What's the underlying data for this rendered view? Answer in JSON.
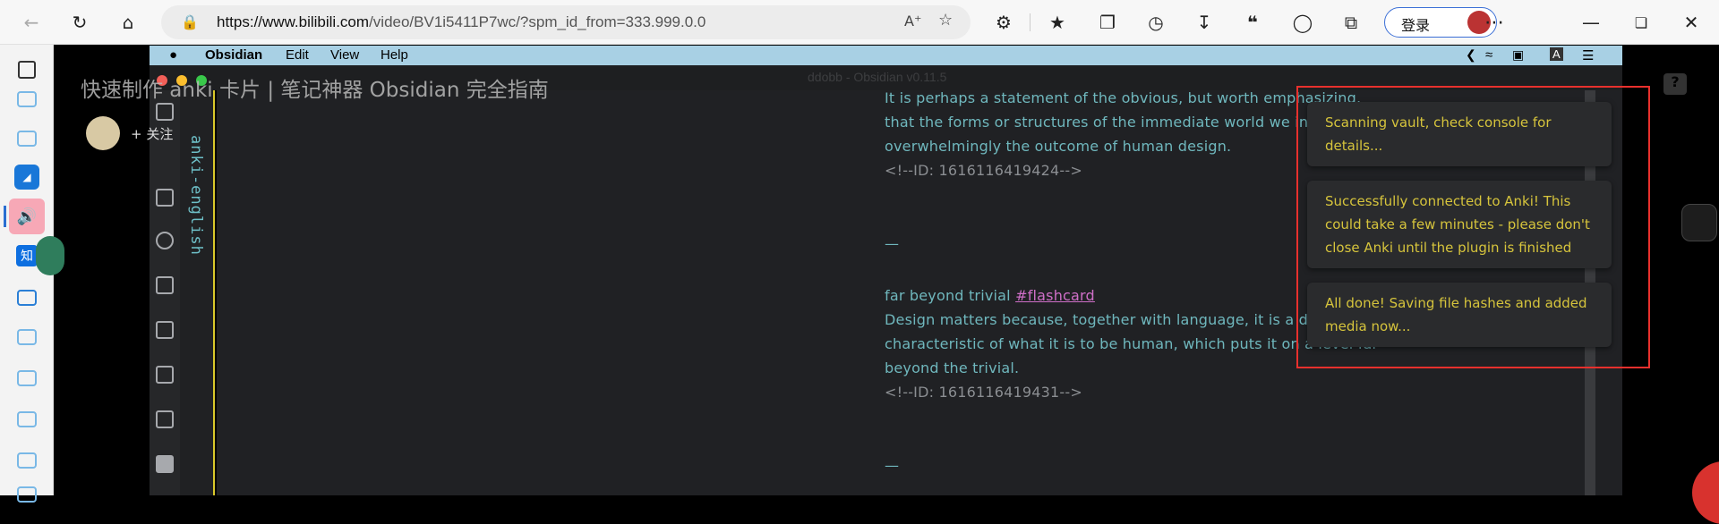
{
  "browser": {
    "url_host": "https://www.bilibili.com",
    "url_path": "/video/BV1i5411P7wc/?spm_id_from=333.999.0.0",
    "login_label": "登录",
    "toolbar_icons": [
      "back-icon",
      "refresh-icon",
      "home-icon",
      "read-aloud-icon",
      "favorite-add-icon",
      "extensions-icon",
      "favorites-icon",
      "collections-icon",
      "history-icon",
      "downloads-icon",
      "quote-icon",
      "browser-essentials-icon",
      "screenshot-icon",
      "more-icon"
    ],
    "window_controls": [
      "minimize",
      "restore",
      "close"
    ]
  },
  "edge_sidebar": {
    "icons": [
      "tabs-icon",
      "bilibili-tv-icon",
      "bilibili-tv-icon",
      "blue-square-icon",
      "speaker-icon",
      "zhihu-icon",
      "bilibili-tv-icon",
      "bilibili-tv-icon",
      "bilibili-tv-icon",
      "bilibili-tv-icon",
      "bilibili-tv-icon",
      "bilibili-tv-icon"
    ],
    "zhihu_label": "知"
  },
  "video": {
    "title": "快速制作 anki 卡片 | 笔记神器 Obsidian 完全指南",
    "follow_label": "关注",
    "help_label": "?"
  },
  "obsidian": {
    "menu": {
      "apple": "",
      "app": "Obsidian",
      "items": [
        "Edit",
        "View",
        "Help"
      ]
    },
    "window_title": "ddobb - Obsidian v0.11.5",
    "folder": "anki-english",
    "editor": {
      "lines": [
        "It is perhaps a statement of the obvious, but worth emphasizing,",
        "that the forms or structures of the immediate world we inhabit are",
        "overwhelmingly the outcome of human design.",
        "<!--ID: 1616116419424-->",
        "—",
        "far beyond trivial ",
        "Design matters because, together with language, it is a defining",
        "characteristic of what it is to be human, which puts it on a level far",
        "beyond the trivial.",
        "<!--ID: 1616116419431-->",
        "—"
      ],
      "tag": "#flashcard"
    },
    "notices": [
      "Scanning vault, check console for details...",
      "Successfully connected to Anki! This could take a few minutes - please don't close Anki until the plugin is finished",
      "All done! Saving file hashes and added media now..."
    ]
  },
  "colors": {
    "highlight_box": "#e8302d",
    "notice_text": "#d6c43c",
    "editor_text": "#6fb7bd",
    "tag": "#cf6fc8"
  }
}
